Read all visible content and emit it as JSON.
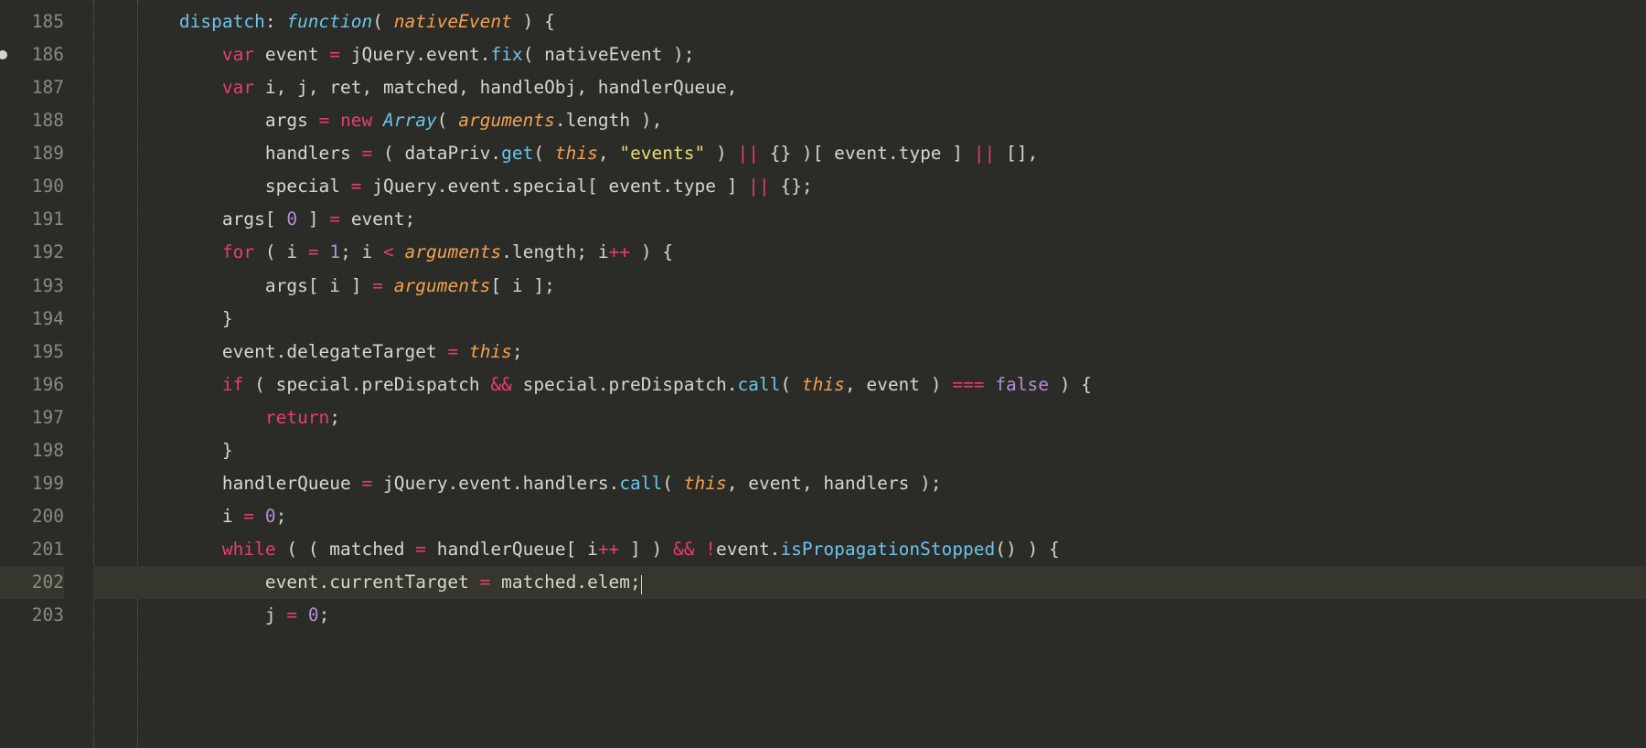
{
  "gutter": {
    "start": 185,
    "end": 203,
    "modified_lines": [
      186
    ],
    "current_line": 202
  },
  "cursor": {
    "line": 202
  },
  "code_lines": [
    {
      "n": 185,
      "indent": 2,
      "tokens": [
        {
          "c": "decl",
          "t": "dispatch"
        },
        {
          "c": "punc",
          "t": ": "
        },
        {
          "c": "stor",
          "t": "function"
        },
        {
          "c": "punc",
          "t": "( "
        },
        {
          "c": "param",
          "t": "nativeEvent"
        },
        {
          "c": "punc",
          "t": " ) {"
        }
      ]
    },
    {
      "n": 186,
      "indent": 3,
      "tokens": [
        {
          "c": "kw",
          "t": "var"
        },
        {
          "c": "punc",
          "t": " "
        },
        {
          "c": "ident",
          "t": "event"
        },
        {
          "c": "punc",
          "t": " "
        },
        {
          "c": "op",
          "t": "="
        },
        {
          "c": "punc",
          "t": " jQuery.event."
        },
        {
          "c": "func",
          "t": "fix"
        },
        {
          "c": "punc",
          "t": "( nativeEvent );"
        }
      ]
    },
    {
      "n": 187,
      "indent": 3,
      "tokens": [
        {
          "c": "kw",
          "t": "var"
        },
        {
          "c": "punc",
          "t": " i, j, ret, matched, handleObj, handlerQueue,"
        }
      ]
    },
    {
      "n": 188,
      "indent": 4,
      "tokens": [
        {
          "c": "ident",
          "t": "args"
        },
        {
          "c": "punc",
          "t": " "
        },
        {
          "c": "op",
          "t": "="
        },
        {
          "c": "punc",
          "t": " "
        },
        {
          "c": "kw",
          "t": "new"
        },
        {
          "c": "punc",
          "t": " "
        },
        {
          "c": "type",
          "t": "Array"
        },
        {
          "c": "punc",
          "t": "( "
        },
        {
          "c": "param",
          "t": "arguments"
        },
        {
          "c": "punc",
          "t": ".length ),"
        }
      ]
    },
    {
      "n": 189,
      "indent": 4,
      "tokens": [
        {
          "c": "ident",
          "t": "handlers"
        },
        {
          "c": "punc",
          "t": " "
        },
        {
          "c": "op",
          "t": "="
        },
        {
          "c": "punc",
          "t": " ( dataPriv."
        },
        {
          "c": "func",
          "t": "get"
        },
        {
          "c": "punc",
          "t": "( "
        },
        {
          "c": "thisk",
          "t": "this"
        },
        {
          "c": "punc",
          "t": ", "
        },
        {
          "c": "str",
          "t": "\"events\""
        },
        {
          "c": "punc",
          "t": " ) "
        },
        {
          "c": "op",
          "t": "||"
        },
        {
          "c": "punc",
          "t": " {} )[ event.type ] "
        },
        {
          "c": "op",
          "t": "||"
        },
        {
          "c": "punc",
          "t": " [],"
        }
      ]
    },
    {
      "n": 190,
      "indent": 4,
      "tokens": [
        {
          "c": "ident",
          "t": "special"
        },
        {
          "c": "punc",
          "t": " "
        },
        {
          "c": "op",
          "t": "="
        },
        {
          "c": "punc",
          "t": " jQuery.event.special[ event.type ] "
        },
        {
          "c": "op",
          "t": "||"
        },
        {
          "c": "punc",
          "t": " {};"
        }
      ]
    },
    {
      "n": 191,
      "indent": 3,
      "tokens": [
        {
          "c": "ident",
          "t": "args"
        },
        {
          "c": "punc",
          "t": "[ "
        },
        {
          "c": "num",
          "t": "0"
        },
        {
          "c": "punc",
          "t": " ] "
        },
        {
          "c": "op",
          "t": "="
        },
        {
          "c": "punc",
          "t": " event;"
        }
      ]
    },
    {
      "n": 192,
      "indent": 3,
      "tokens": [
        {
          "c": "kw",
          "t": "for"
        },
        {
          "c": "punc",
          "t": " ( i "
        },
        {
          "c": "op",
          "t": "="
        },
        {
          "c": "punc",
          "t": " "
        },
        {
          "c": "num",
          "t": "1"
        },
        {
          "c": "punc",
          "t": "; i "
        },
        {
          "c": "op",
          "t": "<"
        },
        {
          "c": "punc",
          "t": " "
        },
        {
          "c": "param",
          "t": "arguments"
        },
        {
          "c": "punc",
          "t": ".length; i"
        },
        {
          "c": "op",
          "t": "++"
        },
        {
          "c": "punc",
          "t": " ) {"
        }
      ]
    },
    {
      "n": 193,
      "indent": 4,
      "tokens": [
        {
          "c": "ident",
          "t": "args"
        },
        {
          "c": "punc",
          "t": "[ i ] "
        },
        {
          "c": "op",
          "t": "="
        },
        {
          "c": "punc",
          "t": " "
        },
        {
          "c": "param",
          "t": "arguments"
        },
        {
          "c": "punc",
          "t": "[ i ];"
        }
      ]
    },
    {
      "n": 194,
      "indent": 3,
      "tokens": [
        {
          "c": "punc",
          "t": "}"
        }
      ]
    },
    {
      "n": 195,
      "indent": 3,
      "tokens": [
        {
          "c": "ident",
          "t": "event.delegateTarget"
        },
        {
          "c": "punc",
          "t": " "
        },
        {
          "c": "op",
          "t": "="
        },
        {
          "c": "punc",
          "t": " "
        },
        {
          "c": "thisk",
          "t": "this"
        },
        {
          "c": "punc",
          "t": ";"
        }
      ]
    },
    {
      "n": 196,
      "indent": 3,
      "tokens": [
        {
          "c": "kw",
          "t": "if"
        },
        {
          "c": "punc",
          "t": " ( special.preDispatch "
        },
        {
          "c": "op",
          "t": "&&"
        },
        {
          "c": "punc",
          "t": " special.preDispatch."
        },
        {
          "c": "func",
          "t": "call"
        },
        {
          "c": "punc",
          "t": "( "
        },
        {
          "c": "thisk",
          "t": "this"
        },
        {
          "c": "punc",
          "t": ", event ) "
        },
        {
          "c": "op",
          "t": "==="
        },
        {
          "c": "punc",
          "t": " "
        },
        {
          "c": "bool",
          "t": "false"
        },
        {
          "c": "punc",
          "t": " ) {"
        }
      ]
    },
    {
      "n": 197,
      "indent": 4,
      "tokens": [
        {
          "c": "kw",
          "t": "return"
        },
        {
          "c": "punc",
          "t": ";"
        }
      ]
    },
    {
      "n": 198,
      "indent": 3,
      "tokens": [
        {
          "c": "punc",
          "t": "}"
        }
      ]
    },
    {
      "n": 199,
      "indent": 3,
      "tokens": [
        {
          "c": "ident",
          "t": "handlerQueue"
        },
        {
          "c": "punc",
          "t": " "
        },
        {
          "c": "op",
          "t": "="
        },
        {
          "c": "punc",
          "t": " jQuery.event.handlers."
        },
        {
          "c": "func",
          "t": "call"
        },
        {
          "c": "punc",
          "t": "( "
        },
        {
          "c": "thisk",
          "t": "this"
        },
        {
          "c": "punc",
          "t": ", event, handlers );"
        }
      ]
    },
    {
      "n": 200,
      "indent": 3,
      "tokens": [
        {
          "c": "ident",
          "t": "i"
        },
        {
          "c": "punc",
          "t": " "
        },
        {
          "c": "op",
          "t": "="
        },
        {
          "c": "punc",
          "t": " "
        },
        {
          "c": "num",
          "t": "0"
        },
        {
          "c": "punc",
          "t": ";"
        }
      ]
    },
    {
      "n": 201,
      "indent": 3,
      "tokens": [
        {
          "c": "kw",
          "t": "while"
        },
        {
          "c": "punc",
          "t": " ( ( matched "
        },
        {
          "c": "op",
          "t": "="
        },
        {
          "c": "punc",
          "t": " handlerQueue[ i"
        },
        {
          "c": "op",
          "t": "++"
        },
        {
          "c": "punc",
          "t": " ] ) "
        },
        {
          "c": "op",
          "t": "&&"
        },
        {
          "c": "punc",
          "t": " "
        },
        {
          "c": "op",
          "t": "!"
        },
        {
          "c": "punc",
          "t": "event."
        },
        {
          "c": "func",
          "t": "isPropagationStopped"
        },
        {
          "c": "punc",
          "t": "() ) {"
        }
      ]
    },
    {
      "n": 202,
      "indent": 4,
      "tokens": [
        {
          "c": "ident",
          "t": "event.currentTarget"
        },
        {
          "c": "punc",
          "t": " "
        },
        {
          "c": "op",
          "t": "="
        },
        {
          "c": "punc",
          "t": " matched.elem;"
        }
      ]
    },
    {
      "n": 203,
      "indent": 4,
      "tokens": [
        {
          "c": "ident",
          "t": "j"
        },
        {
          "c": "punc",
          "t": " "
        },
        {
          "c": "op",
          "t": "="
        },
        {
          "c": "punc",
          "t": " "
        },
        {
          "c": "num",
          "t": "0"
        },
        {
          "c": "punc",
          "t": ";"
        }
      ]
    }
  ]
}
